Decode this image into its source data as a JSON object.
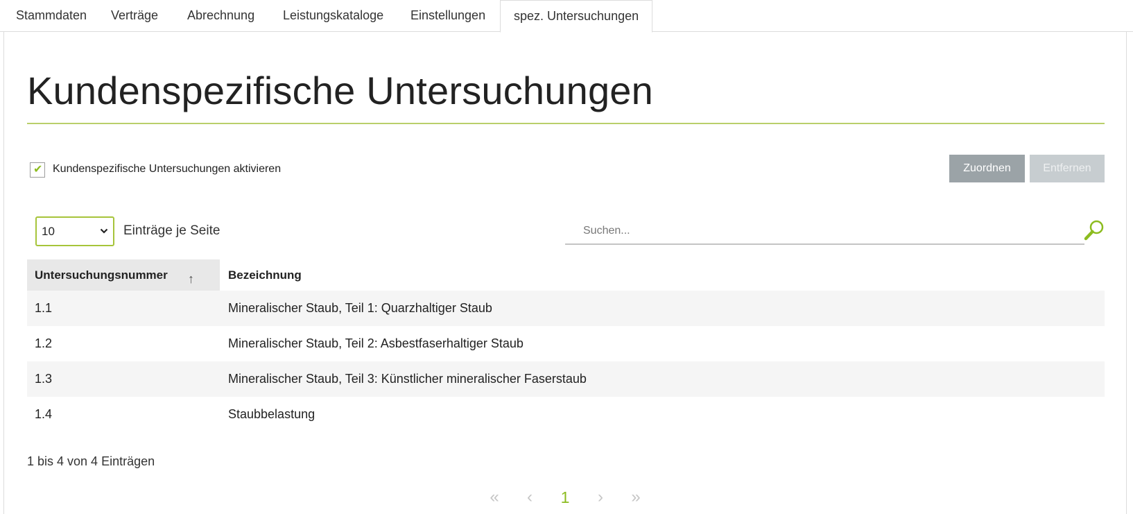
{
  "tabs": [
    {
      "label": "Stammdaten"
    },
    {
      "label": "Verträge"
    },
    {
      "label": "Abrechnung"
    },
    {
      "label": "Leistungskataloge"
    },
    {
      "label": "Einstellungen"
    },
    {
      "label": "spez. Untersuchungen",
      "active": true
    }
  ],
  "page": {
    "title": "Kundenspezifische Untersuchungen"
  },
  "activation": {
    "label": "Kundenspezifische Untersuchungen aktivieren",
    "checked": true,
    "check_glyph": "✔"
  },
  "actions": {
    "assign_label": "Zuordnen",
    "remove_label": "Entfernen"
  },
  "length_menu": {
    "value": "10",
    "chevron": "⌄",
    "label": "Einträge je Seite"
  },
  "search": {
    "placeholder": "Suchen...",
    "icon": "search-icon"
  },
  "table": {
    "columns": [
      {
        "label": "Untersuchungsnummer",
        "sort": "↑"
      },
      {
        "label": "Bezeichnung"
      }
    ],
    "rows": [
      {
        "num": "1.1",
        "desc": "Mineralischer Staub, Teil 1: Quarzhaltiger Staub"
      },
      {
        "num": "1.2",
        "desc": "Mineralischer Staub, Teil 2: Asbestfaserhaltiger Staub"
      },
      {
        "num": "1.3",
        "desc": "Mineralischer Staub, Teil 3: Künstlicher mineralischer Faserstaub"
      },
      {
        "num": "1.4",
        "desc": "Staubbelastung"
      }
    ]
  },
  "info": "1 bis 4 von 4 Einträgen",
  "pagination": {
    "first": "«",
    "prev": "‹",
    "current": "1",
    "next": "›",
    "last": "»"
  },
  "colors": {
    "accent": "#8cbc1f",
    "rule": "#b9cf6a",
    "button_primary": "#9ba3a7",
    "button_disabled": "#c7cdd0"
  }
}
